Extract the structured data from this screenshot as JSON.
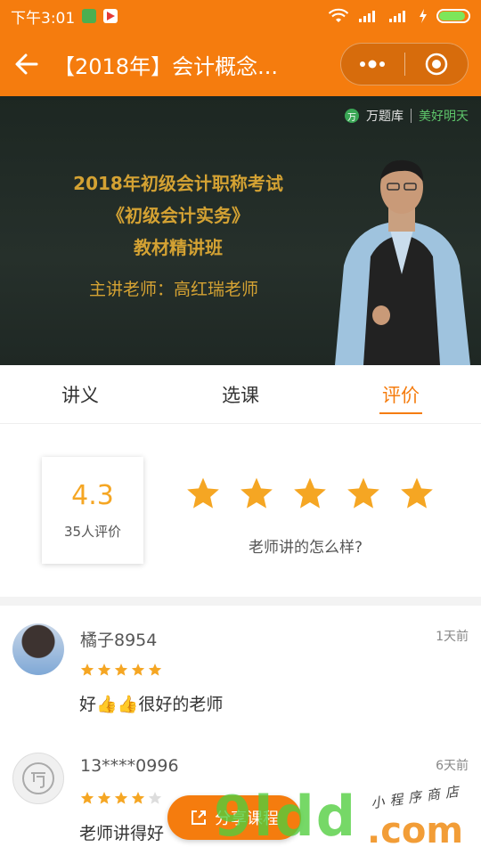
{
  "status_bar": {
    "time": "下午3:01"
  },
  "nav": {
    "title": "【2018年】会计概念..."
  },
  "video": {
    "brand_a": "万题库",
    "brand_b": "美好明天",
    "slide_lines": [
      "2018年初级会计职称考试",
      "《初级会计实务》",
      "教材精讲班"
    ],
    "teacher": "主讲老师：高红瑞老师"
  },
  "tabs": [
    {
      "label": "讲义",
      "active": false
    },
    {
      "label": "选课",
      "active": false
    },
    {
      "label": "评价",
      "active": true
    }
  ],
  "rating": {
    "score": "4.3",
    "count_label": "35人评价",
    "stars_max": 5,
    "prompt": "老师讲的怎么样?"
  },
  "reviews": [
    {
      "name": "橘子8954",
      "time": "1天前",
      "stars": 5,
      "text": "好👍👍很好的老师"
    },
    {
      "name": "13****0996",
      "time": "6天前",
      "stars": 4,
      "text": "老师讲得好"
    }
  ],
  "share_button": {
    "label": "分享课程"
  },
  "watermark": {
    "main": "9ldd",
    "suffix": ".com",
    "sub": "小程序商店"
  },
  "colors": {
    "accent": "#f57c0e",
    "star": "#f5a623",
    "star_empty": "#dddddd"
  }
}
